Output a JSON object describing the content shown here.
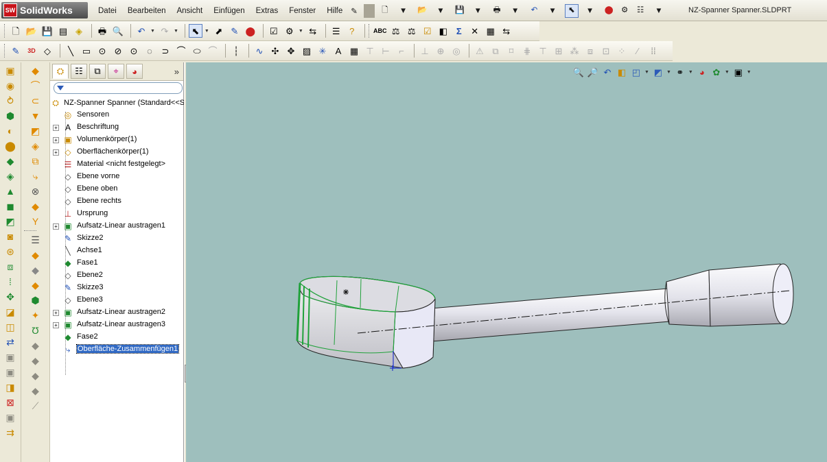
{
  "app": {
    "logo_mark": "SW",
    "logo_text": "SolidWorks"
  },
  "menu": [
    "Datei",
    "Bearbeiten",
    "Ansicht",
    "Einfügen",
    "Extras",
    "Fenster",
    "Hilfe"
  ],
  "document_title": "NZ-Spanner Spanner.SLDPRT",
  "tree": {
    "root": "NZ-Spanner Spanner  (Standard<<S",
    "items": [
      {
        "label": "Sensoren",
        "icon": "sensor-icon",
        "expandable": false
      },
      {
        "label": "Beschriftung",
        "icon": "annotation-icon",
        "expandable": true
      },
      {
        "label": "Volumenkörper(1)",
        "icon": "solid-body-icon",
        "expandable": true
      },
      {
        "label": "Oberflächenkörper(1)",
        "icon": "surface-body-icon",
        "expandable": true
      },
      {
        "label": "Material <nicht festgelegt>",
        "icon": "material-icon",
        "expandable": false
      },
      {
        "label": "Ebene vorne",
        "icon": "plane-icon",
        "expandable": false
      },
      {
        "label": "Ebene oben",
        "icon": "plane-icon",
        "expandable": false
      },
      {
        "label": "Ebene rechts",
        "icon": "plane-icon",
        "expandable": false
      },
      {
        "label": "Ursprung",
        "icon": "origin-icon",
        "expandable": false
      },
      {
        "label": "Aufsatz-Linear austragen1",
        "icon": "extrude-icon",
        "expandable": true
      },
      {
        "label": "Skizze2",
        "icon": "sketch-icon",
        "expandable": false
      },
      {
        "label": "Achse1",
        "icon": "axis-icon",
        "expandable": false
      },
      {
        "label": "Fase1",
        "icon": "chamfer-icon",
        "expandable": false
      },
      {
        "label": "Ebene2",
        "icon": "plane-icon",
        "expandable": false
      },
      {
        "label": "Skizze3",
        "icon": "sketch-icon",
        "expandable": false
      },
      {
        "label": "Ebene3",
        "icon": "plane-icon",
        "expandable": false
      },
      {
        "label": "Aufsatz-Linear austragen2",
        "icon": "extrude-icon",
        "expandable": true
      },
      {
        "label": "Aufsatz-Linear austragen3",
        "icon": "extrude-icon",
        "expandable": true
      },
      {
        "label": "Fase2",
        "icon": "chamfer-icon",
        "expandable": false
      },
      {
        "label": "Oberfläche-Zusammenfügen1",
        "icon": "knit-surface-icon",
        "expandable": false,
        "selected": true
      }
    ]
  },
  "colors": {
    "viewport": "#9ebfbd",
    "selection": "#316ac5",
    "edge_highlight": "#1fa13a"
  }
}
